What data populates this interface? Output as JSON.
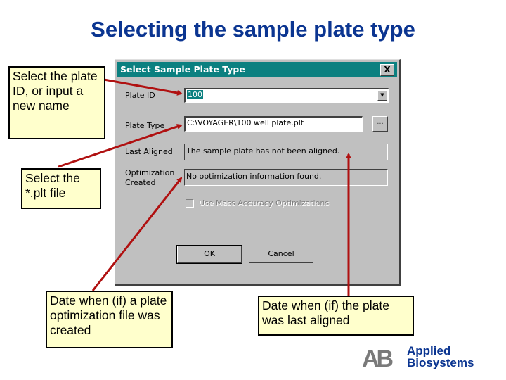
{
  "slide": {
    "title": "Selecting the sample plate type"
  },
  "dialog": {
    "title": "Select Sample Plate Type",
    "close_label": "X",
    "plate_id": {
      "label": "Plate ID",
      "value": "100"
    },
    "plate_type": {
      "label": "Plate Type",
      "value": "C:\\VOYAGER\\100 well plate.plt",
      "browse_label": "..."
    },
    "last_aligned": {
      "label": "Last Aligned",
      "value": "The sample plate has not been aligned."
    },
    "optimization_created": {
      "label_line1": "Optimization",
      "label_line2": "Created",
      "value": "No optimization information found."
    },
    "mass_accuracy_checkbox": {
      "label": "Use Mass Accuracy Optimizations",
      "checked": false,
      "enabled": false
    },
    "ok_label": "OK",
    "cancel_label": "Cancel"
  },
  "callouts": {
    "plate_id": "Select the plate ID, or input a new name",
    "plt_file": "Select the *.plt file",
    "optimization": "Date when (if) a plate optimization file was created",
    "aligned": "Date when (if) the plate was last aligned"
  },
  "logo": {
    "mark": "AB",
    "line1": "Applied",
    "line2": "Biosystems"
  },
  "colors": {
    "title": "#0b3591",
    "titlebar": "#0b8080",
    "arrow": "#b01010",
    "callout_bg": "#ffffcc",
    "dialog_bg": "#c0c0c0"
  }
}
